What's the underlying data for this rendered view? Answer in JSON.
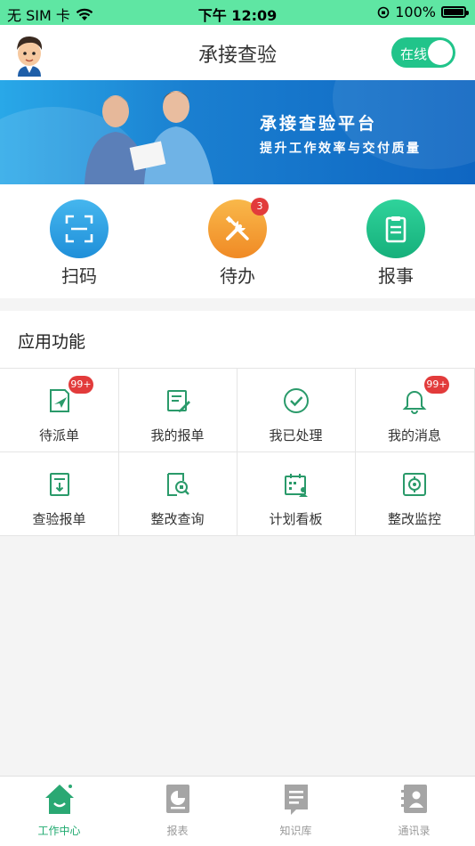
{
  "status_bar": {
    "carrier": "无 SIM 卡",
    "time": "下午 12:09",
    "battery": "100%"
  },
  "header": {
    "title": "承接查验",
    "toggle_label": "在线"
  },
  "banner": {
    "title": "承接查验平台",
    "subtitle": "提升工作效率与交付质量"
  },
  "quick_actions": [
    {
      "label": "扫码",
      "icon": "scan-icon",
      "badge": ""
    },
    {
      "label": "待办",
      "icon": "tools-icon",
      "badge": "3"
    },
    {
      "label": "报事",
      "icon": "clipboard-icon",
      "badge": ""
    }
  ],
  "section": {
    "title": "应用功能",
    "items": [
      {
        "label": "待派单",
        "icon": "dispatch-icon",
        "badge": "99+"
      },
      {
        "label": "我的报单",
        "icon": "edit-doc-icon",
        "badge": ""
      },
      {
        "label": "我已处理",
        "icon": "check-circle-icon",
        "badge": ""
      },
      {
        "label": "我的消息",
        "icon": "bell-icon",
        "badge": "99+"
      },
      {
        "label": "查验报单",
        "icon": "report-doc-icon",
        "badge": ""
      },
      {
        "label": "整改查询",
        "icon": "search-doc-icon",
        "badge": ""
      },
      {
        "label": "计划看板",
        "icon": "calendar-board-icon",
        "badge": ""
      },
      {
        "label": "整改监控",
        "icon": "monitor-icon",
        "badge": ""
      }
    ]
  },
  "tabbar": {
    "tabs": [
      {
        "label": "工作中心",
        "active": true
      },
      {
        "label": "报表",
        "active": false
      },
      {
        "label": "知识库",
        "active": false
      },
      {
        "label": "通讯录",
        "active": false
      }
    ]
  },
  "colors": {
    "accent": "#1faa6f",
    "status_bar": "#5fe6a3",
    "badge": "#e23b3b"
  }
}
